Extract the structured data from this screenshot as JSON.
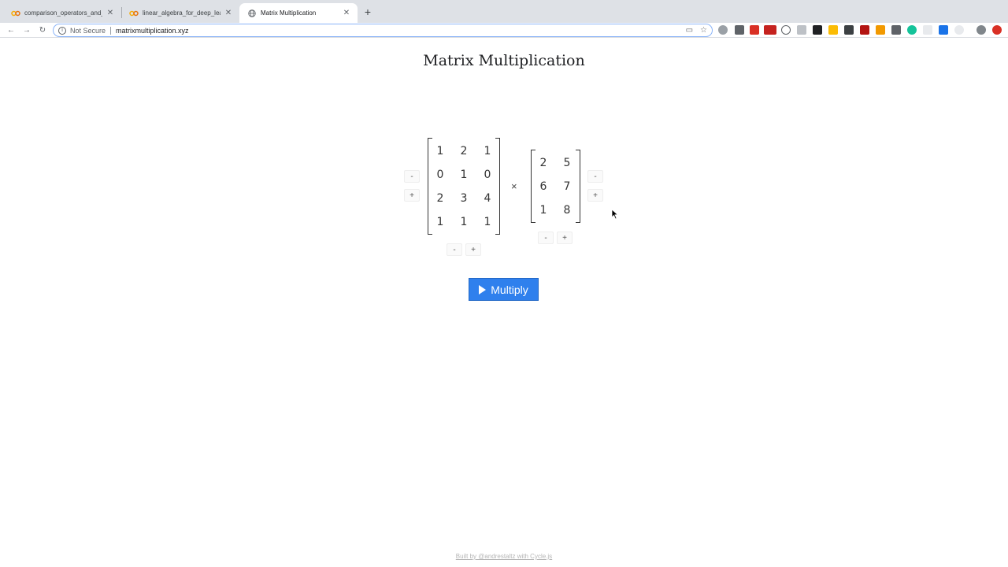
{
  "browser": {
    "tabs": [
      {
        "title": "comparison_operators_and_bo",
        "active": false
      },
      {
        "title": "linear_algebra_for_deep_learni",
        "active": false
      },
      {
        "title": "Matrix Multiplication",
        "active": true
      }
    ],
    "address": {
      "security": "Not Secure",
      "url": "matrixmultiplication.xyz"
    }
  },
  "page": {
    "title": "Matrix Multiplication",
    "operator": "×",
    "matrix_a": [
      [
        "1",
        "2",
        "1"
      ],
      [
        "0",
        "1",
        "0"
      ],
      [
        "2",
        "3",
        "4"
      ],
      [
        "1",
        "1",
        "1"
      ]
    ],
    "matrix_b": [
      [
        "2",
        "5"
      ],
      [
        "6",
        "7"
      ],
      [
        "1",
        "8"
      ]
    ],
    "controls": {
      "minus": "-",
      "plus": "+"
    },
    "multiply_label": "Multiply",
    "footer": "Built by @andrestaltz with Cycle.js"
  },
  "colors": {
    "accent": "#2f80ed"
  }
}
